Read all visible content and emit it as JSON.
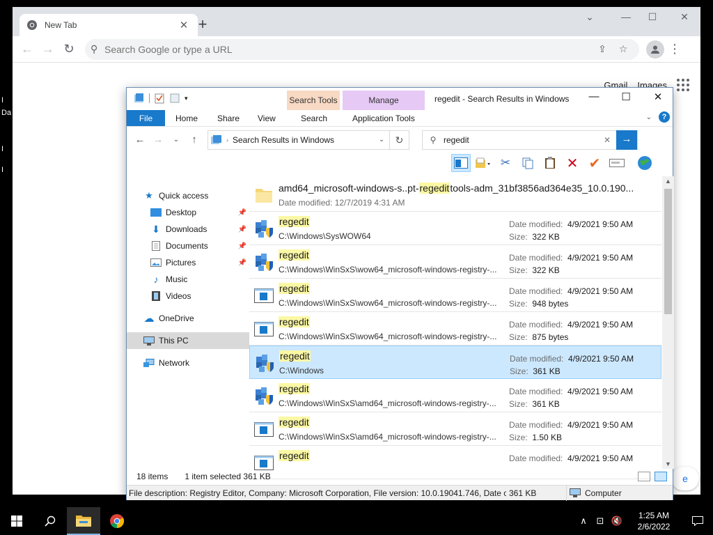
{
  "chrome": {
    "tab_title": "New Tab",
    "omnibox_placeholder": "Search Google or type a URL",
    "gmail_label": "Gmail",
    "images_label": "Images",
    "side_button_label": "e"
  },
  "desktop_fragments": [
    "I",
    "Da",
    "I",
    "I"
  ],
  "explorer": {
    "window_title": "regedit - Search Results in Windows",
    "context_tabs": {
      "search_tools": "Search Tools",
      "manage": "Manage"
    },
    "ribbon_tabs": {
      "file": "File",
      "home": "Home",
      "share": "Share",
      "view": "View",
      "search": "Search",
      "application_tools": "Application Tools"
    },
    "address": "Search Results in Windows",
    "search_value": "regedit",
    "nav": {
      "quick_access": "Quick access",
      "quick_items": [
        "Desktop",
        "Downloads",
        "Documents",
        "Pictures",
        "Music",
        "Videos"
      ],
      "onedrive": "OneDrive",
      "this_pc": "This PC",
      "network": "Network"
    },
    "first_result": {
      "name_prefix": "amd64_microsoft-windows-s..pt-",
      "name_highlight": "regedit",
      "name_suffix": "tools-adm_31bf3856ad364e35_10.0.190...",
      "date_line": "Date modified:  12/7/2019 4:31 AM"
    },
    "date_label": "Date modified:",
    "size_label": "Size:",
    "results": [
      {
        "name": "regedit",
        "path": "C:\\Windows\\SysWOW64",
        "date": "4/9/2021 9:50 AM",
        "size": "322 KB",
        "icon": "regedit-icon"
      },
      {
        "name": "regedit",
        "path": "C:\\Windows\\WinSxS\\wow64_microsoft-windows-registry-...",
        "date": "4/9/2021 9:50 AM",
        "size": "322 KB",
        "icon": "regedit-icon"
      },
      {
        "name": "regedit",
        "path": "C:\\Windows\\WinSxS\\wow64_microsoft-windows-registry-...",
        "date": "4/9/2021 9:50 AM",
        "size": "948 bytes",
        "icon": "manifest-icon"
      },
      {
        "name": "regedit",
        "path": "C:\\Windows\\WinSxS\\wow64_microsoft-windows-registry-...",
        "date": "4/9/2021 9:50 AM",
        "size": "875 bytes",
        "icon": "manifest-icon"
      },
      {
        "name": "regedit",
        "path": "C:\\Windows",
        "date": "4/9/2021 9:50 AM",
        "size": "361 KB",
        "icon": "regedit-icon",
        "selected": true
      },
      {
        "name": "regedit",
        "path": "C:\\Windows\\WinSxS\\amd64_microsoft-windows-registry-...",
        "date": "4/9/2021 9:50 AM",
        "size": "361 KB",
        "icon": "regedit-icon"
      },
      {
        "name": "regedit",
        "path": "C:\\Windows\\WinSxS\\amd64_microsoft-windows-registry-...",
        "date": "4/9/2021 9:50 AM",
        "size": "1.50 KB",
        "icon": "manifest-icon"
      },
      {
        "name": "regedit",
        "path": "",
        "date": "4/9/2021 9:50 AM",
        "size": "",
        "icon": "manifest-icon"
      }
    ],
    "status": {
      "count": "18 items",
      "selected": "1 item selected  361 KB"
    },
    "details_bar": {
      "description": "File description: Registry Editor, Company: Microsoft Corporation, File version: 10.0.19041.746, Date crea",
      "size": "361 KB",
      "location": "Computer"
    }
  },
  "taskbar": {
    "time": "1:25 AM",
    "date": "2/6/2022"
  }
}
